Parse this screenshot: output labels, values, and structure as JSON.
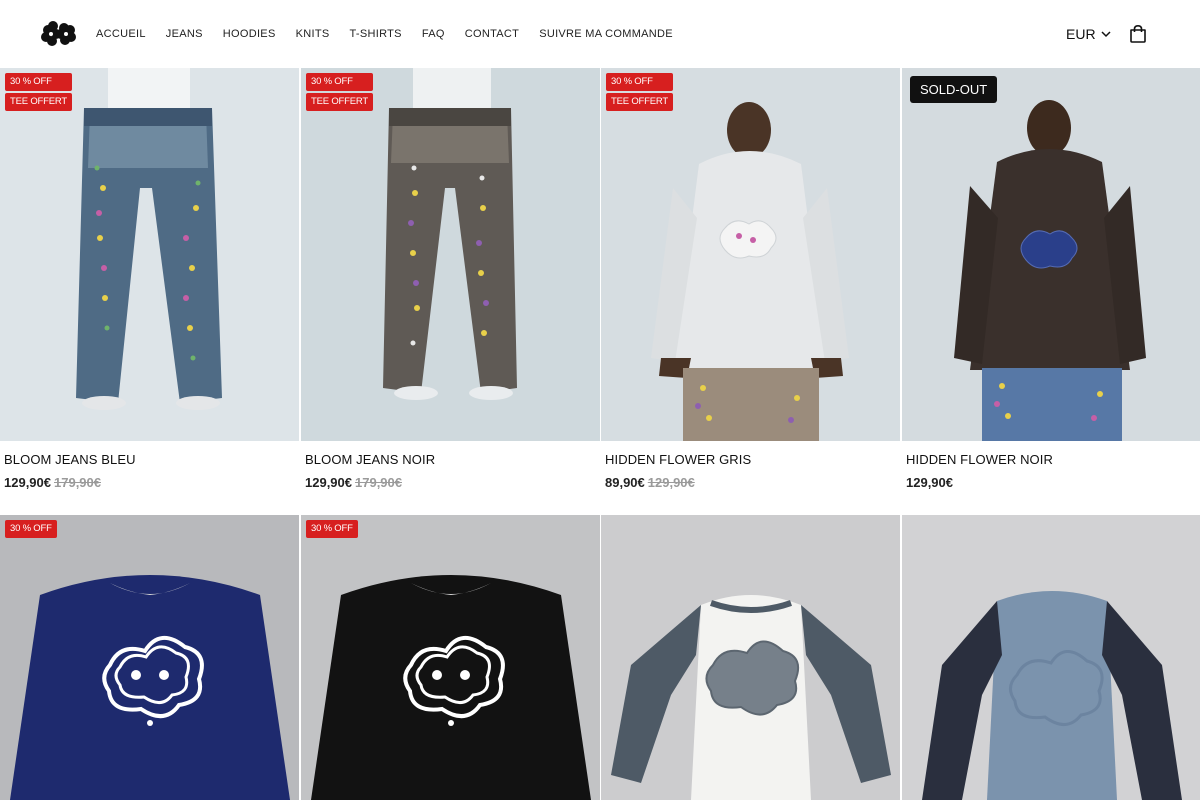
{
  "header": {
    "nav": [
      "ACCUEIL",
      "JEANS",
      "HOODIES",
      "KNITS",
      "T-SHIRTS",
      "FAQ",
      "CONTACT",
      "SUIVRE MA COMMANDE"
    ],
    "currency": "EUR"
  },
  "products": [
    {
      "name": "BLOOM JEANS BLEU",
      "price": "129,90€",
      "old_price": "179,90€",
      "badges": [
        "30 % OFF",
        "TEE OFFERT"
      ]
    },
    {
      "name": "BLOOM JEANS NOIR",
      "price": "129,90€",
      "old_price": "179,90€",
      "badges": [
        "30 % OFF",
        "TEE OFFERT"
      ]
    },
    {
      "name": "HIDDEN FLOWER GRIS",
      "price": "89,90€",
      "old_price": "129,90€",
      "badges": [
        "30 % OFF",
        "TEE OFFERT"
      ]
    },
    {
      "name": "HIDDEN FLOWER NOIR",
      "price": "129,90€",
      "status": "SOLD-OUT"
    },
    {
      "badges": [
        "30 % OFF"
      ]
    },
    {
      "badges": [
        "30 % OFF"
      ]
    },
    {},
    {}
  ]
}
